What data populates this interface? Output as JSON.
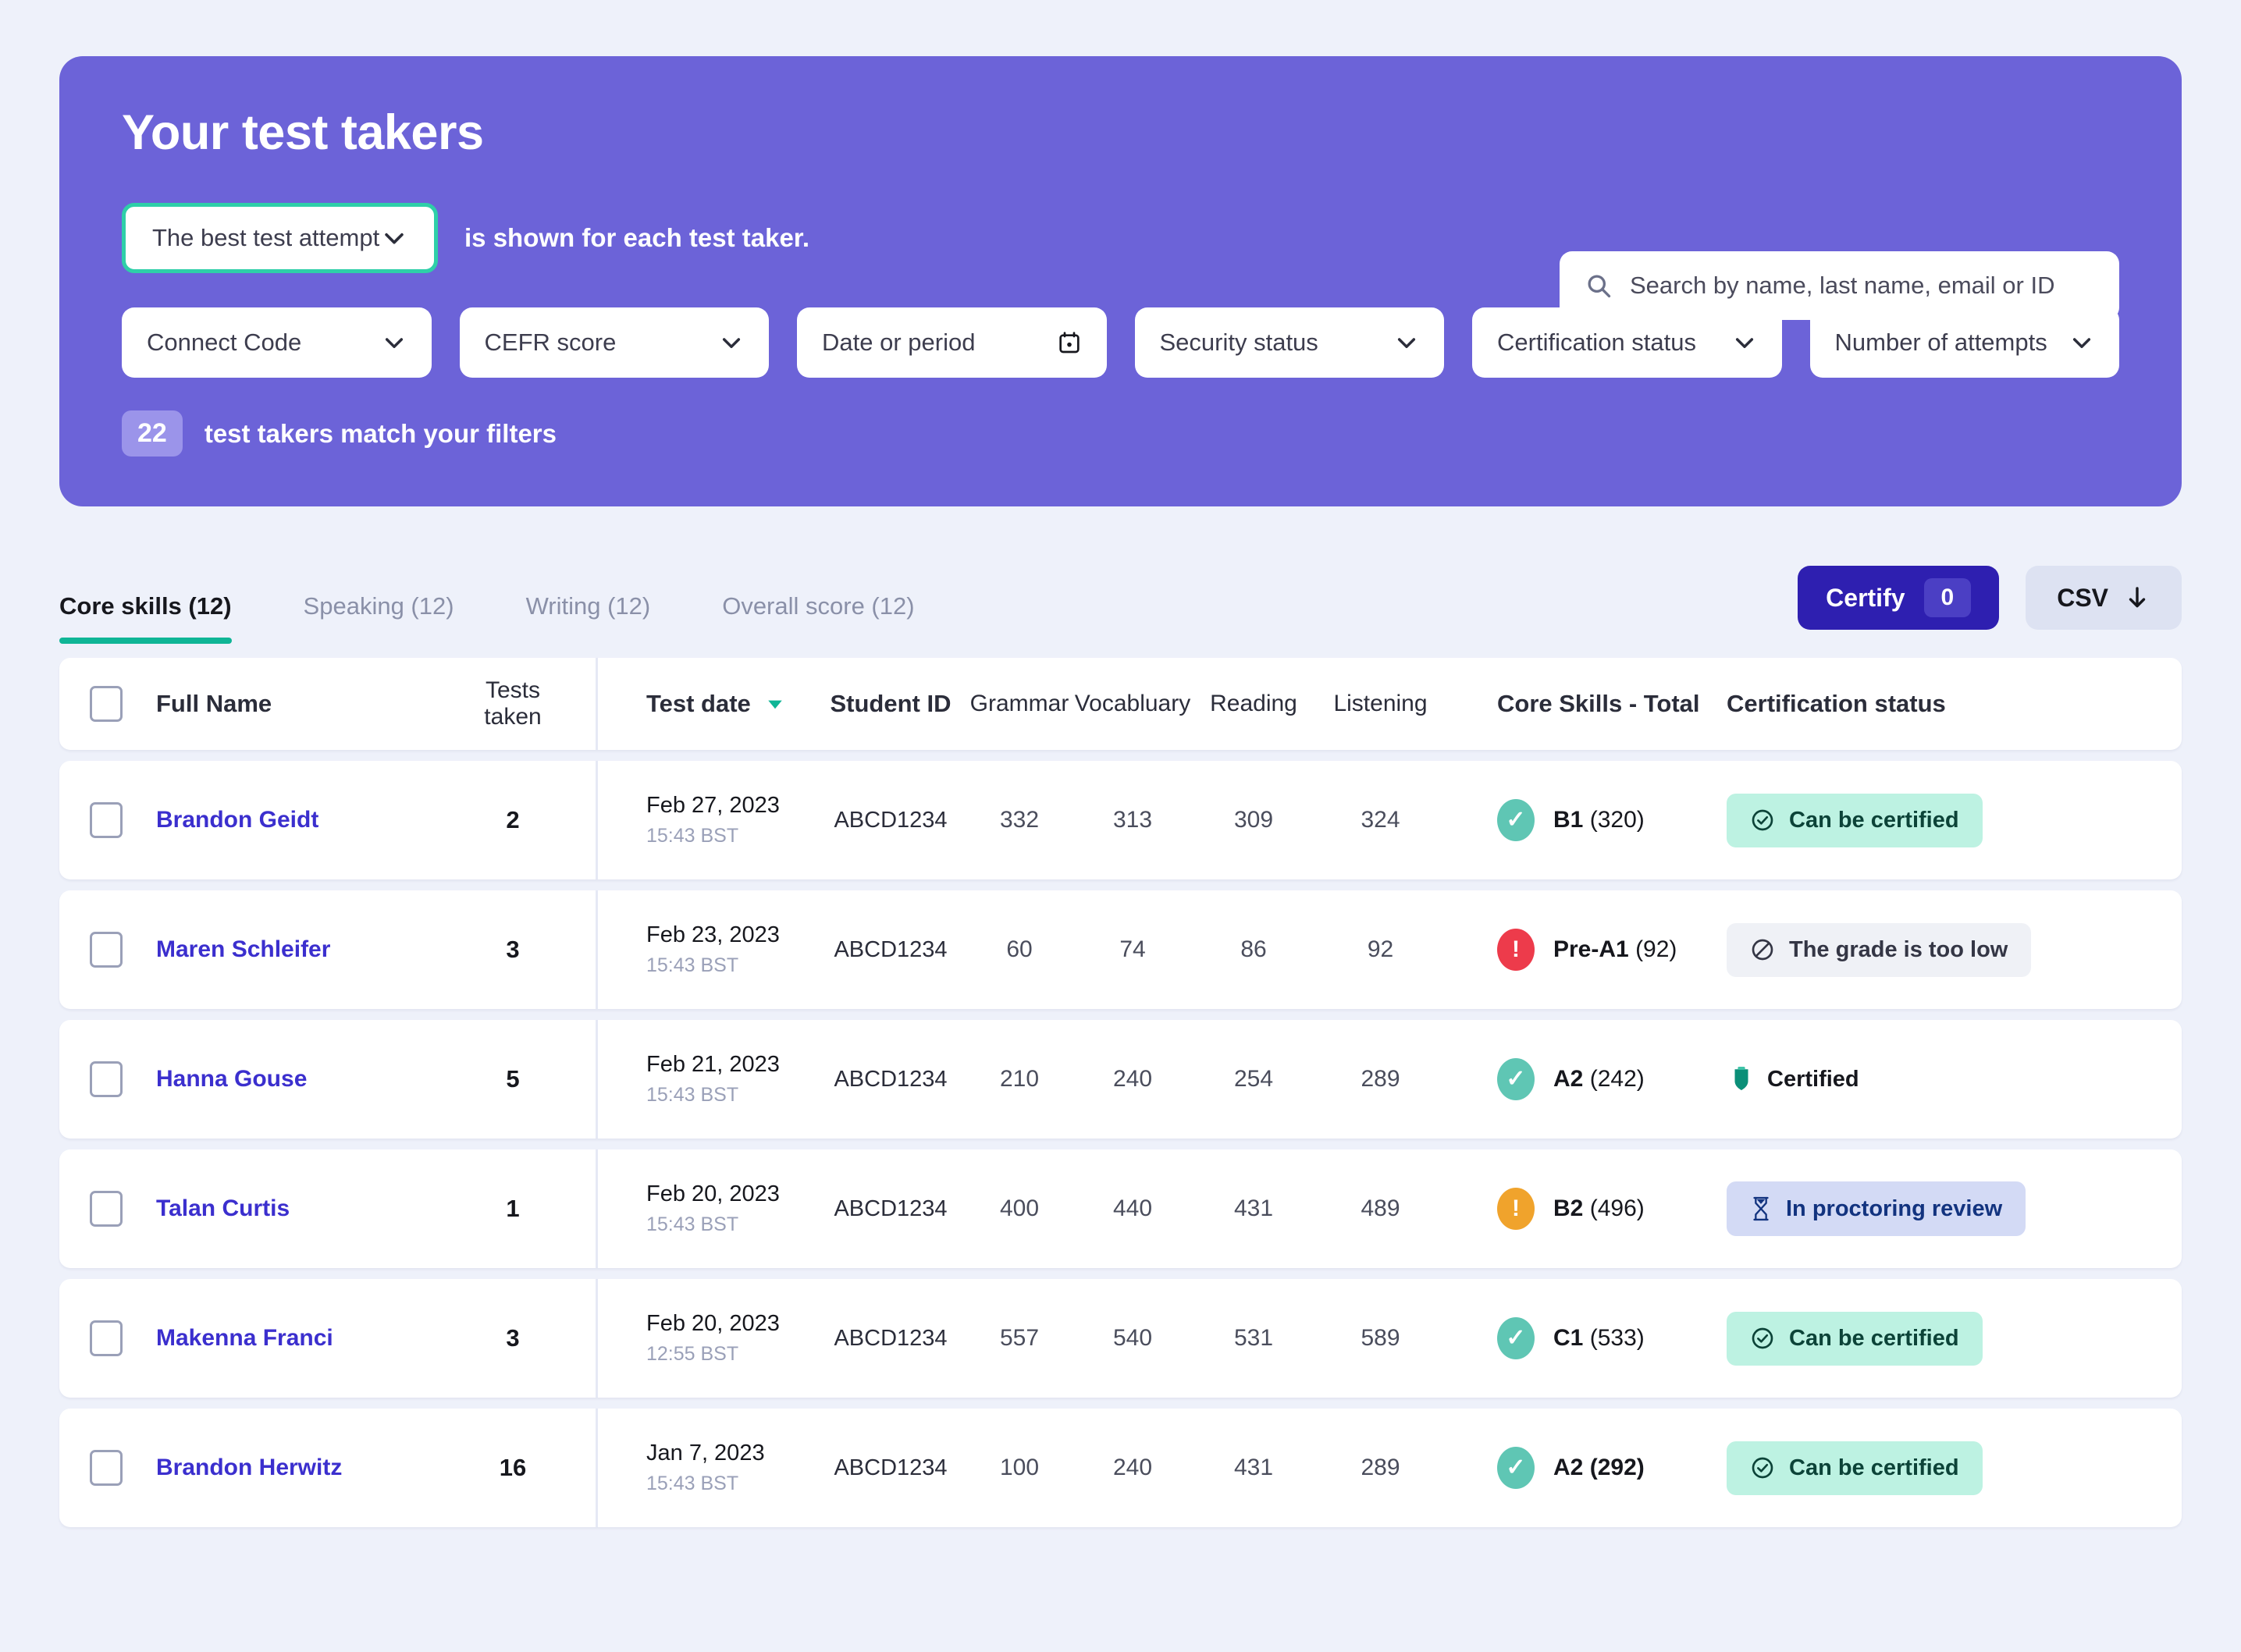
{
  "hero": {
    "title": "Your test takers",
    "attempt_select": {
      "value": "The best test attempt",
      "icon": "chevron-down-icon"
    },
    "attempt_note": "is shown for each test taker.",
    "search": {
      "placeholder": "Search by name, last name, email or ID",
      "value": "",
      "icon": "search-icon"
    },
    "filters": [
      {
        "label": "Connect Code",
        "icon": "chevron-down-icon"
      },
      {
        "label": "CEFR score",
        "icon": "chevron-down-icon"
      },
      {
        "label": "Date or period",
        "icon": "calendar-icon"
      },
      {
        "label": "Security status",
        "icon": "chevron-down-icon"
      },
      {
        "label": "Certification status",
        "icon": "chevron-down-icon"
      },
      {
        "label": "Number of attempts",
        "icon": "chevron-down-icon"
      }
    ],
    "match_count": "22",
    "match_text": "test takers match your filters"
  },
  "tabs": [
    {
      "label": "Core skills (12)",
      "active": true
    },
    {
      "label": "Speaking (12)",
      "active": false
    },
    {
      "label": "Writing (12)",
      "active": false
    },
    {
      "label": "Overall score (12)",
      "active": false
    }
  ],
  "actions": {
    "certify_label": "Certify",
    "certify_count": "0",
    "csv_label": "CSV",
    "csv_icon": "download-arrow-icon"
  },
  "table": {
    "headers": {
      "full_name": "Full Name",
      "tests_taken_line1": "Tests",
      "tests_taken_line2": "taken",
      "test_date": "Test date",
      "sort_icon": "sort-descending-triangle-icon",
      "student_id": "Student ID",
      "grammar": "Grammar",
      "vocabulary": "Vocabluary",
      "reading": "Reading",
      "listening": "Listening",
      "core_skills_total": "Core Skills - Total",
      "certification_status": "Certification status"
    },
    "rows": [
      {
        "name": "Brandon Geidt",
        "tests_taken": "2",
        "date": "Feb 27, 2023",
        "time": "15:43 BST",
        "student_id": "ABCD1234",
        "grammar": "332",
        "vocabulary": "313",
        "reading": "309",
        "listening": "324",
        "status_kind": "ok",
        "status_glyph": "✓",
        "total_level": "B1",
        "total_score": "(320)",
        "total_bold_all": false,
        "cert_label": "Can be certified",
        "cert_kind": "green",
        "cert_icon": "check-circle-icon"
      },
      {
        "name": "Maren Schleifer",
        "tests_taken": "3",
        "date": "Feb 23, 2023",
        "time": "15:43 BST",
        "student_id": "ABCD1234",
        "grammar": "60",
        "vocabulary": "74",
        "reading": "86",
        "listening": "92",
        "status_kind": "err",
        "status_glyph": "!",
        "total_level": "Pre-A1",
        "total_score": "(92)",
        "total_bold_all": false,
        "cert_label": "The grade is too low",
        "cert_kind": "grey",
        "cert_icon": "no-entry-icon"
      },
      {
        "name": "Hanna Gouse",
        "tests_taken": "5",
        "date": "Feb 21, 2023",
        "time": "15:43 BST",
        "student_id": "ABCD1234",
        "grammar": "210",
        "vocabulary": "240",
        "reading": "254",
        "listening": "289",
        "status_kind": "ok",
        "status_glyph": "✓",
        "total_level": "A2",
        "total_score": "(242)",
        "total_bold_all": false,
        "cert_label": "Certified",
        "cert_kind": "plain",
        "cert_icon": "shield-icon"
      },
      {
        "name": "Talan Curtis",
        "tests_taken": "1",
        "date": "Feb 20, 2023",
        "time": "15:43 BST",
        "student_id": "ABCD1234",
        "grammar": "400",
        "vocabulary": "440",
        "reading": "431",
        "listening": "489",
        "status_kind": "warn",
        "status_glyph": "!",
        "total_level": "B2",
        "total_score": "(496)",
        "total_bold_all": false,
        "cert_label": "In proctoring review",
        "cert_kind": "blue",
        "cert_icon": "hourglass-icon"
      },
      {
        "name": "Makenna Franci",
        "tests_taken": "3",
        "date": "Feb 20, 2023",
        "time": "12:55 BST",
        "student_id": "ABCD1234",
        "grammar": "557",
        "vocabulary": "540",
        "reading": "531",
        "listening": "589",
        "status_kind": "ok",
        "status_glyph": "✓",
        "total_level": "C1",
        "total_score": "(533)",
        "total_bold_all": false,
        "cert_label": "Can be certified",
        "cert_kind": "green",
        "cert_icon": "check-circle-icon"
      },
      {
        "name": "Brandon Herwitz",
        "tests_taken": "16",
        "date": "Jan 7, 2023",
        "time": "15:43 BST",
        "student_id": "ABCD1234",
        "grammar": "100",
        "vocabulary": "240",
        "reading": "431",
        "listening": "289",
        "status_kind": "ok",
        "status_glyph": "✓",
        "total_level": "A2",
        "total_score": "(292)",
        "total_bold_all": true,
        "cert_label": "Can be certified",
        "cert_kind": "green",
        "cert_icon": "check-circle-icon"
      }
    ]
  },
  "colors": {
    "hero_purple": "#6C63D8",
    "teal_accent": "#2ECFA8",
    "tab_underline": "#0FB596",
    "certify_blue": "#2E1FB0",
    "link_blue": "#3B2FCE",
    "status_ok": "#5FC6B4",
    "status_error": "#ED3B4B",
    "status_warn": "#F0A32C",
    "page_bg": "#EEF1FA"
  }
}
